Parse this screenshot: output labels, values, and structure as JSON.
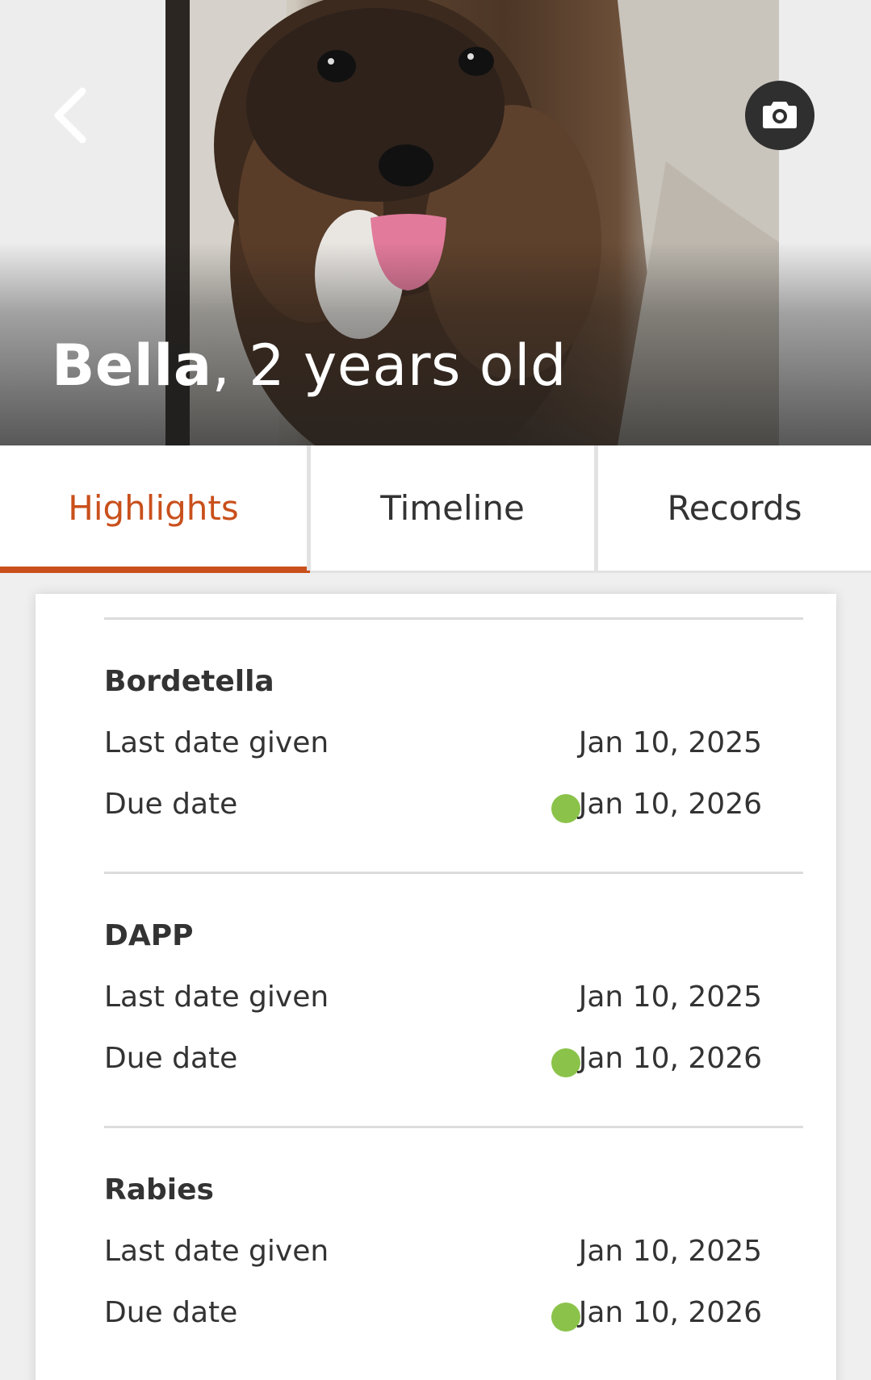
{
  "pet": {
    "name": "Bella",
    "age_text": ", 2 years old"
  },
  "tabs": [
    {
      "label": "Highlights",
      "active": true
    },
    {
      "label": "Timeline",
      "active": false
    },
    {
      "label": "Records",
      "active": false
    }
  ],
  "colors": {
    "accent": "#c9501c",
    "status_ok": "#8bc34a"
  },
  "vaccines": [
    {
      "name": "Bordetella",
      "last_label": "Last date given",
      "last_value": "Jan 10, 2025",
      "due_label": "Due date",
      "due_value": "Jan 10, 2026",
      "due_status": "ok"
    },
    {
      "name": "DAPP",
      "last_label": "Last date given",
      "last_value": "Jan 10, 2025",
      "due_label": "Due date",
      "due_value": "Jan 10, 2026",
      "due_status": "ok"
    },
    {
      "name": "Rabies",
      "last_label": "Last date given",
      "last_value": "Jan 10, 2025",
      "due_label": "Due date",
      "due_value": "Jan 10, 2026",
      "due_status": "ok"
    }
  ],
  "icons": {
    "back": "chevron-left-icon",
    "camera": "camera-icon"
  }
}
